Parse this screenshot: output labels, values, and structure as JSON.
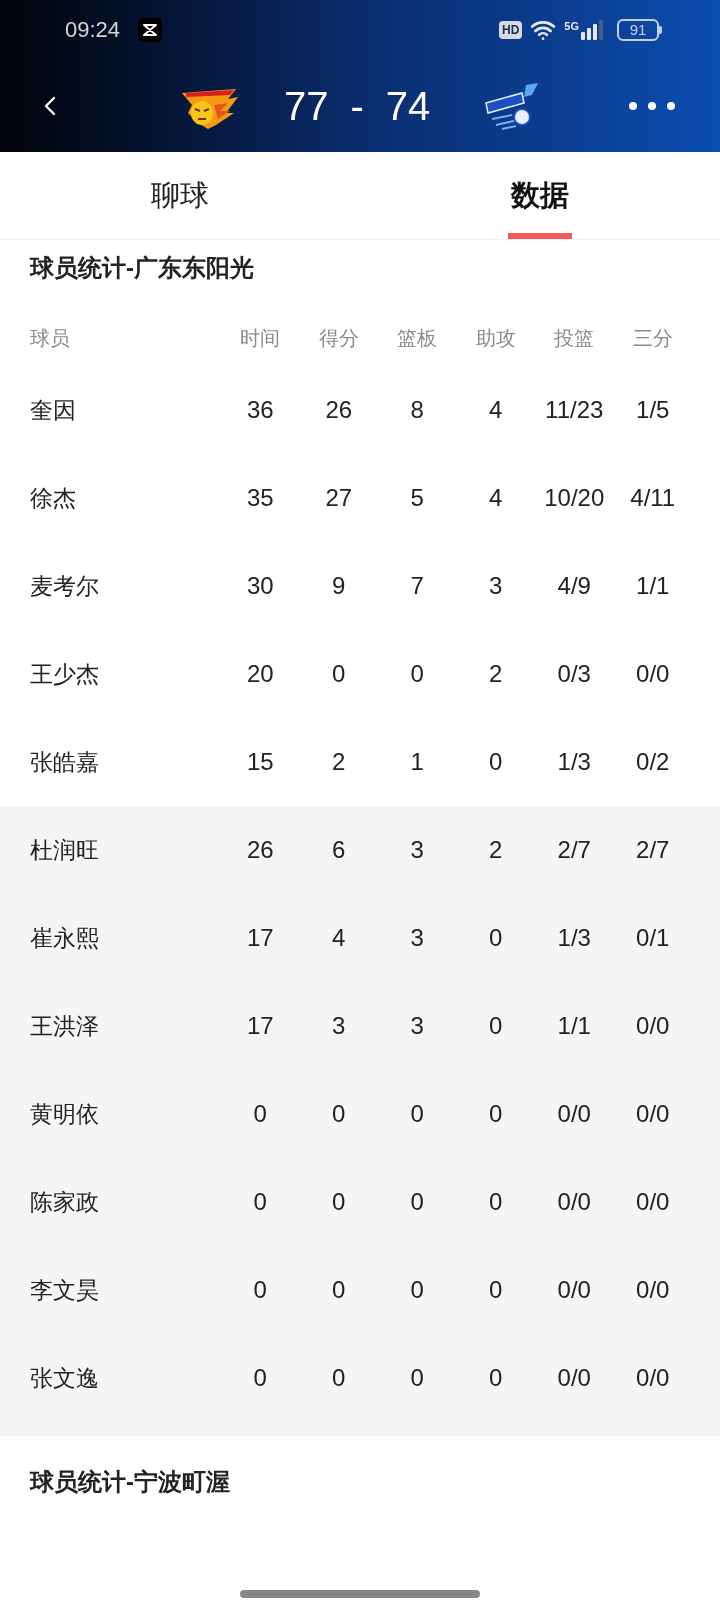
{
  "status_bar": {
    "time": "09:24",
    "hd": "HD",
    "network": "5G",
    "battery": "91"
  },
  "header": {
    "home_score": "77",
    "separator": "-",
    "away_score": "74"
  },
  "tabs": [
    {
      "label": "聊球",
      "selected": false
    },
    {
      "label": "数据",
      "selected": true
    }
  ],
  "sections": [
    {
      "title": "球员统计-广东东阳光",
      "columns": [
        "球员",
        "时间",
        "得分",
        "篮板",
        "助攻",
        "投篮",
        "三分"
      ],
      "starters": [
        {
          "player": "奎因",
          "stats": [
            "36",
            "26",
            "8",
            "4",
            "11/23",
            "1/5"
          ]
        },
        {
          "player": "徐杰",
          "stats": [
            "35",
            "27",
            "5",
            "4",
            "10/20",
            "4/11"
          ]
        },
        {
          "player": "麦考尔",
          "stats": [
            "30",
            "9",
            "7",
            "3",
            "4/9",
            "1/1"
          ]
        },
        {
          "player": "王少杰",
          "stats": [
            "20",
            "0",
            "0",
            "2",
            "0/3",
            "0/0"
          ]
        },
        {
          "player": "张皓嘉",
          "stats": [
            "15",
            "2",
            "1",
            "0",
            "1/3",
            "0/2"
          ]
        }
      ],
      "bench": [
        {
          "player": "杜润旺",
          "stats": [
            "26",
            "6",
            "3",
            "2",
            "2/7",
            "2/7"
          ]
        },
        {
          "player": "崔永熙",
          "stats": [
            "17",
            "4",
            "3",
            "0",
            "1/3",
            "0/1"
          ]
        },
        {
          "player": "王洪泽",
          "stats": [
            "17",
            "3",
            "3",
            "0",
            "1/1",
            "0/0"
          ]
        },
        {
          "player": "黄明依",
          "stats": [
            "0",
            "0",
            "0",
            "0",
            "0/0",
            "0/0"
          ]
        },
        {
          "player": "陈家政",
          "stats": [
            "0",
            "0",
            "0",
            "0",
            "0/0",
            "0/0"
          ]
        },
        {
          "player": "李文昊",
          "stats": [
            "0",
            "0",
            "0",
            "0",
            "0/0",
            "0/0"
          ]
        },
        {
          "player": "张文逸",
          "stats": [
            "0",
            "0",
            "0",
            "0",
            "0/0",
            "0/0"
          ]
        }
      ]
    },
    {
      "title": "球员统计-宁波町渥"
    }
  ]
}
